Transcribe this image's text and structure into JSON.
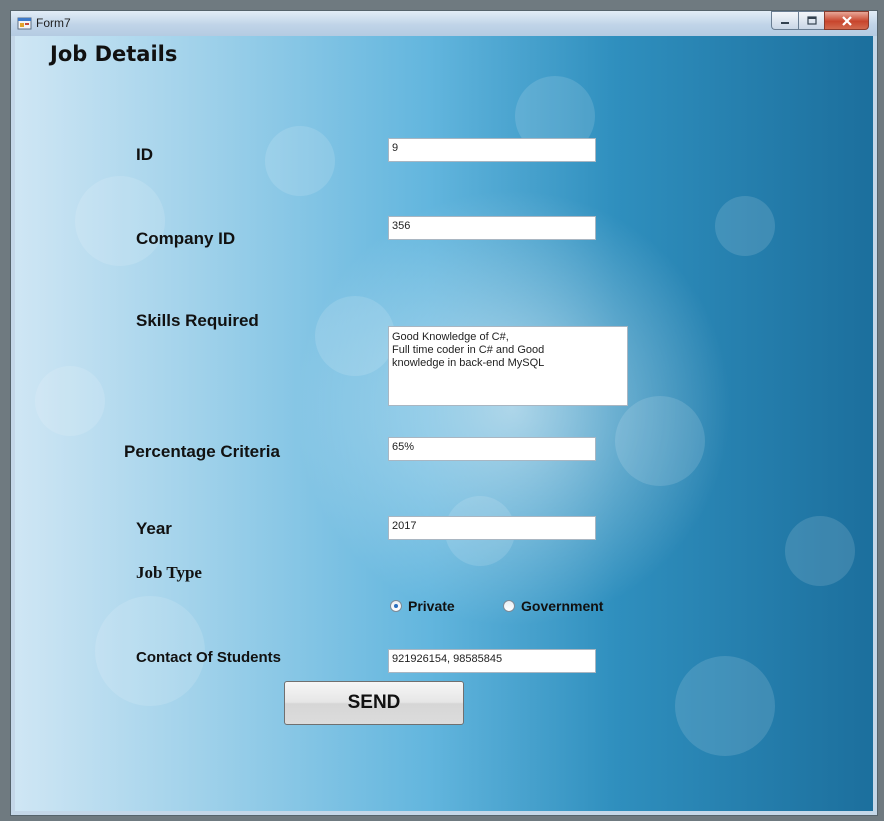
{
  "window": {
    "title": "Form7"
  },
  "form": {
    "heading": "Job Details",
    "id": {
      "label": "ID",
      "value": "9"
    },
    "company_id": {
      "label": "Company ID",
      "value": "356"
    },
    "skills": {
      "label": "Skills Required",
      "value": "Good Knowledge of C#,\nFull time coder in C# and Good\nknowledge in back-end MySQL"
    },
    "percentage": {
      "label": "Percentage Criteria",
      "value": "65%"
    },
    "year": {
      "label": "Year",
      "value": "2017"
    },
    "job_type": {
      "label": "Job Type",
      "options": [
        "Private",
        "Government"
      ],
      "selected": "Private"
    },
    "contact": {
      "label": "Contact Of Students",
      "value": "921926154, 98585845"
    },
    "send_label": "SEND"
  }
}
